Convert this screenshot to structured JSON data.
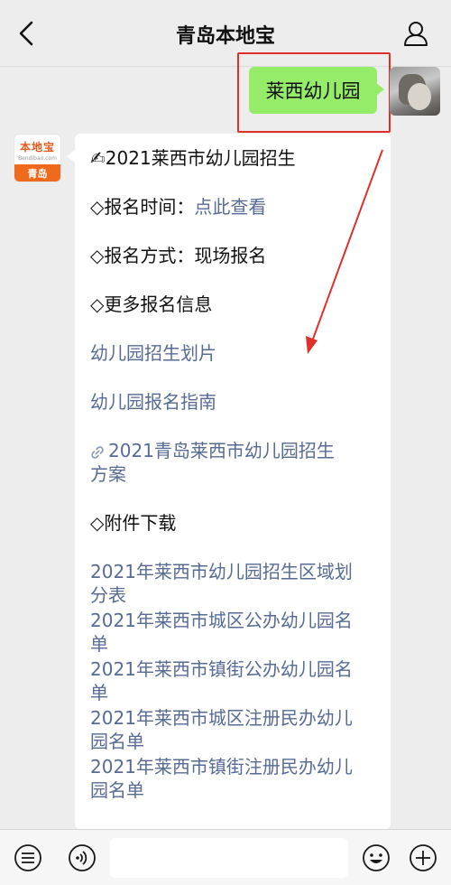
{
  "header": {
    "title": "青岛本地宝"
  },
  "outgoing": {
    "text": "莱西幼儿园"
  },
  "account": {
    "logo_text": "本地宝",
    "logo_sub": "Bendibao.com",
    "logo_city": "青岛"
  },
  "message": {
    "title": "✍2021莱西市幼儿园招生",
    "time_label": "◇报名时间：",
    "time_link": "点此查看",
    "method": "◇报名方式：现场报名",
    "more_info": "◇更多报名信息",
    "links": [
      "幼儿园招生划片",
      "幼儿园报名指南",
      "2021青岛莱西市幼儿园招生",
      "方案"
    ],
    "attachments_heading": "◇附件下载",
    "attachments": [
      "2021年莱西市幼儿园招生区域划",
      "分表",
      "2021年莱西市城区公办幼儿园名",
      "单",
      "2021年莱西市镇街公办幼儿园名",
      "单",
      "2021年莱西市城区注册民办幼儿",
      "园名单",
      "2021年莱西市镇街注册民办幼儿",
      "园名单"
    ]
  },
  "input_bar": {
    "placeholder": ""
  },
  "colors": {
    "outgoing_bubble": "#95ec69",
    "link": "#576b95",
    "highlight": "#e0302c",
    "brand_orange": "#f06a1e"
  },
  "icons": [
    "chevron-left-icon",
    "person-icon",
    "menu-lines-icon",
    "voice-icon",
    "emoji-icon",
    "plus-icon",
    "link-icon"
  ]
}
